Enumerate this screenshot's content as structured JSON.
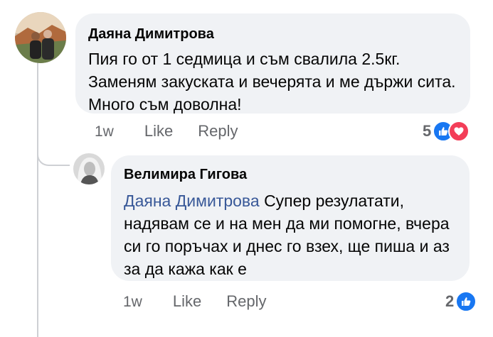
{
  "colors": {
    "bubble_bg": "#f0f2f5",
    "text": "#050505",
    "meta": "#65676b",
    "mention": "#385898",
    "like_blue": "#1877f2",
    "love_red": "#f33e58"
  },
  "comments": [
    {
      "author": "Даяна Димитрова",
      "text": "Пия го от 1 седмица и съм свалила 2.5кг. Заменям закуската и вечерята и ме държи сита. Много съм доволна!",
      "time": "1w",
      "like_label": "Like",
      "reply_label": "Reply",
      "reaction_count": "5",
      "reaction_icons": [
        "like-icon",
        "love-icon"
      ],
      "replies": [
        {
          "author": "Велимира Гигова",
          "mention": "Даяна Димитрова",
          "text": "Супер резулатати, надявам се и на мен да ми помогне, вчера си го поръчах и днес го взех, ще пиша и аз за да кажа как е",
          "time": "1w",
          "like_label": "Like",
          "reply_label": "Reply",
          "reaction_count": "2",
          "reaction_icons": [
            "like-icon"
          ]
        }
      ]
    }
  ]
}
